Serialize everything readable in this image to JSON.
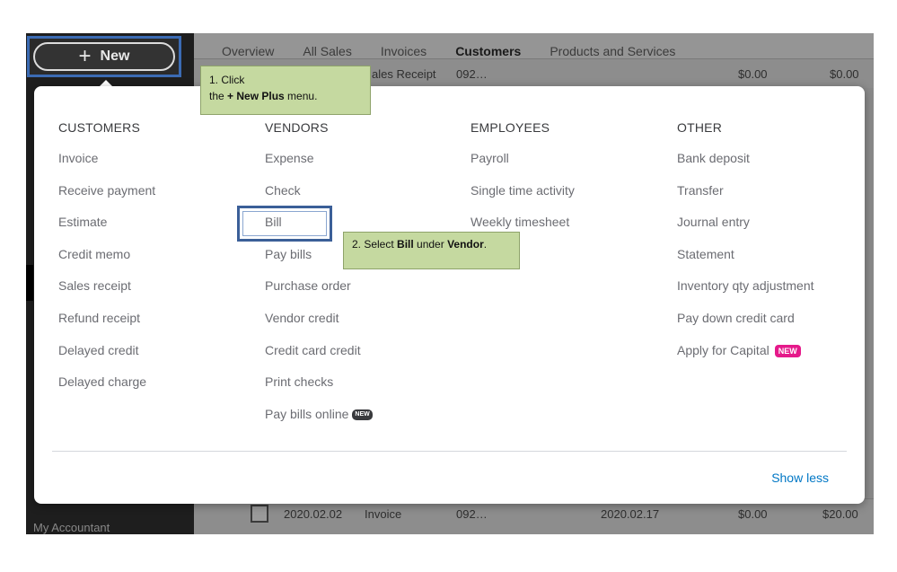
{
  "sidebar": {
    "new_label": "New",
    "footer_label": "My Accountant"
  },
  "tabs": [
    {
      "label": "Overview"
    },
    {
      "label": "All Sales"
    },
    {
      "label": "Invoices"
    },
    {
      "label": "Customers"
    },
    {
      "label": "Products and Services"
    }
  ],
  "bg_rows": {
    "top": {
      "type_fragment": "ales Receipt",
      "num": "092…",
      "amount1": "$0.00",
      "amount2": "$0.00"
    },
    "bottom": {
      "date": "2020.02.02",
      "type": "Invoice",
      "num": "092…",
      "due": "2020.02.17",
      "amount1": "$0.00",
      "amount2": "$20.00"
    }
  },
  "menu": {
    "columns": [
      {
        "heading": "CUSTOMERS",
        "items": [
          "Invoice",
          "Receive payment",
          "Estimate",
          "Credit memo",
          "Sales receipt",
          "Refund receipt",
          "Delayed credit",
          "Delayed charge"
        ]
      },
      {
        "heading": "VENDORS",
        "items": [
          "Expense",
          "Check",
          "Bill",
          "Pay bills",
          "Purchase order",
          "Vendor credit",
          "Credit card credit",
          "Print checks",
          "Pay bills online"
        ]
      },
      {
        "heading": "EMPLOYEES",
        "items": [
          "Payroll",
          "Single time activity",
          "Weekly timesheet"
        ]
      },
      {
        "heading": "OTHER",
        "items": [
          "Bank deposit",
          "Transfer",
          "Journal entry",
          "Statement",
          "Inventory qty adjustment",
          "Pay down credit card",
          "Apply for Capital"
        ]
      }
    ],
    "badge_new": "NEW",
    "show_less": "Show less"
  },
  "callouts": {
    "step1": {
      "line1": "1. Click",
      "prefix": "the ",
      "bold": "+ New Plus",
      "suffix": " menu."
    },
    "step2": {
      "prefix": "2. Select ",
      "bold1": "Bill",
      "mid": " under ",
      "bold2": "Vendor",
      "suffix": "."
    }
  },
  "colors": {
    "accent": "#0077c5",
    "tab_active": "#2b7a2b",
    "badge": "#e5198a",
    "highlight": "#3b5f98",
    "callout_bg": "#c5d9a0"
  }
}
